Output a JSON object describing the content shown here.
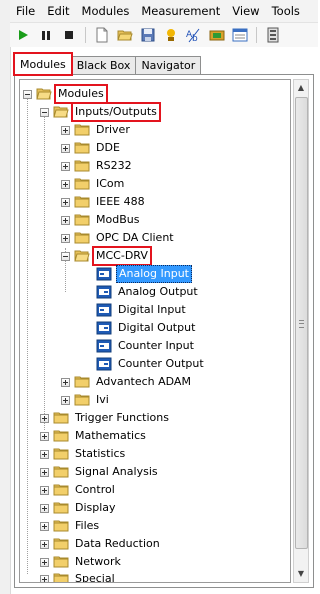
{
  "menubar": {
    "items": [
      "File",
      "Edit",
      "Modules",
      "Measurement",
      "View",
      "Tools"
    ]
  },
  "toolbar": {
    "icons": [
      "play-icon",
      "pause-icon",
      "stop-icon",
      "new-file-icon",
      "open-folder-icon",
      "save-icon",
      "wizard-icon",
      "text-format-icon",
      "module-icon",
      "list-icon",
      "panel-icon"
    ]
  },
  "tabs": [
    {
      "label": "Modules",
      "active": true
    },
    {
      "label": "Black Box",
      "active": false
    },
    {
      "label": "Navigator",
      "active": false
    }
  ],
  "tree": {
    "root": {
      "label": "Modules"
    },
    "io": {
      "label": "Inputs/Outputs"
    },
    "io_children": [
      "Driver",
      "DDE",
      "RS232",
      "ICom",
      "IEEE 488",
      "ModBus",
      "OPC DA Client"
    ],
    "mcc": {
      "label": "MCC-DRV"
    },
    "mcc_children": [
      "Analog Input",
      "Analog Output",
      "Digital Input",
      "Digital Output",
      "Counter Input",
      "Counter Output"
    ],
    "io_after": [
      "Advantech ADAM",
      "Ivi"
    ],
    "top_level": [
      "Trigger Functions",
      "Mathematics",
      "Statistics",
      "Signal Analysis",
      "Control",
      "Display",
      "Files",
      "Data Reduction",
      "Network",
      "Special"
    ],
    "selected": "Analog Input"
  },
  "colors": {
    "highlight": "#e3141e",
    "selection": "#3399ff",
    "folder": "#e8c25c"
  }
}
